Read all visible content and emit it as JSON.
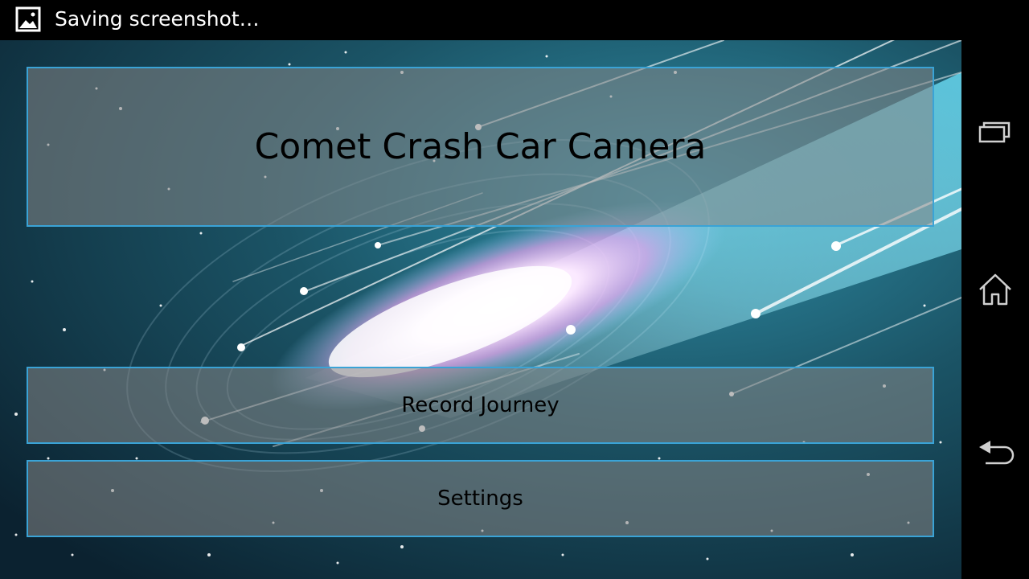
{
  "status_bar": {
    "notification_icon": "image-icon",
    "text": "Saving screenshot…"
  },
  "app": {
    "title": "Comet Crash Car Camera",
    "buttons": {
      "record_label": "Record Journey",
      "settings_label": "Settings"
    },
    "colors": {
      "panel_border": "#3aa3d6",
      "background": "#123a4b"
    }
  },
  "nav_bar": {
    "recent_apps_icon": "recent-apps-icon",
    "home_icon": "home-icon",
    "back_icon": "back-icon"
  }
}
